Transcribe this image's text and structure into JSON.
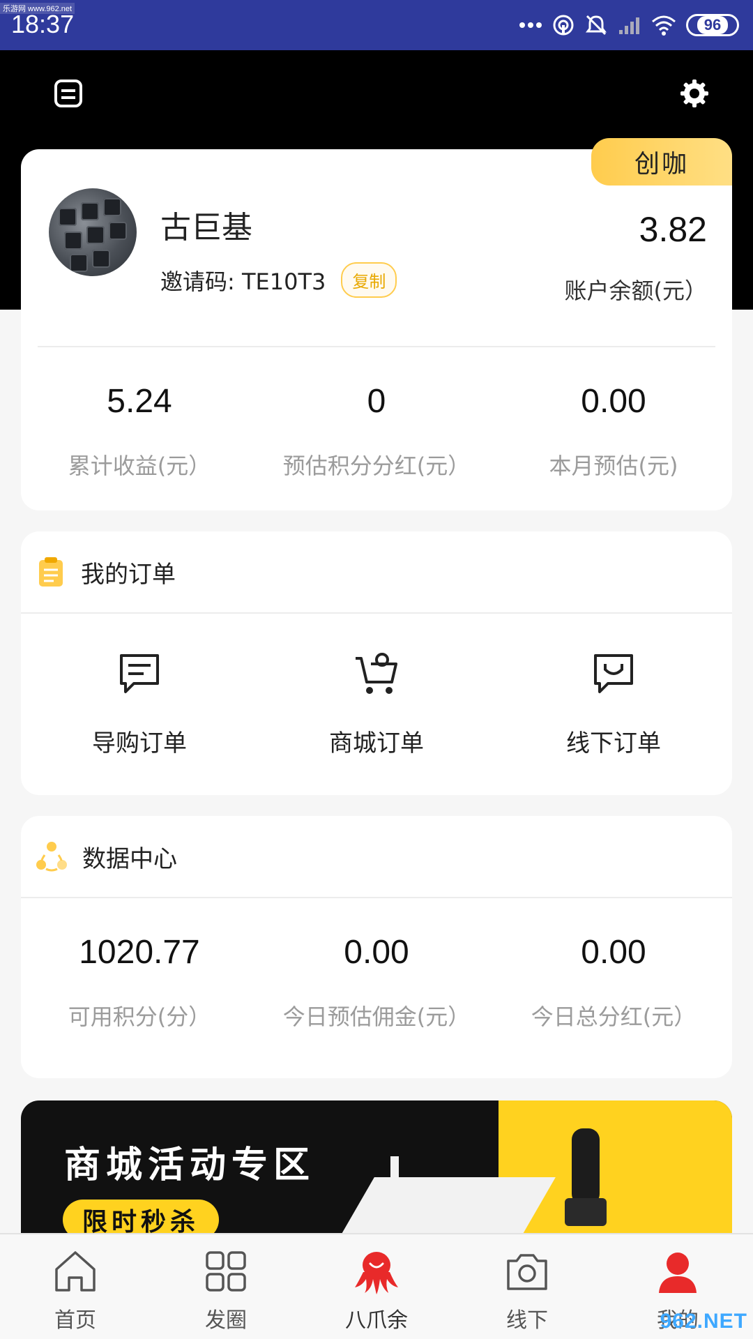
{
  "status_bar": {
    "time": "18:37",
    "battery": "96",
    "watermark": "乐游网 www.962.net"
  },
  "profile": {
    "badge": "创咖",
    "name": "古巨基",
    "invite_label": "邀请码: TE10T3",
    "copy_button": "复制",
    "balance_value": "3.82",
    "balance_label": "账户余额(元）"
  },
  "stats": [
    {
      "value": "5.24",
      "label": "累计收益(元）"
    },
    {
      "value": "0",
      "label": "预估积分分红(元）"
    },
    {
      "value": "0.00",
      "label": "本月预估(元)"
    }
  ],
  "orders": {
    "title": "我的订单",
    "items": [
      {
        "label": "导购订单",
        "icon": "message-square-icon"
      },
      {
        "label": "商城订单",
        "icon": "cart-icon"
      },
      {
        "label": "线下订单",
        "icon": "smile-bag-icon"
      }
    ]
  },
  "data_center": {
    "title": "数据中心",
    "items": [
      {
        "value": "1020.77",
        "label": "可用积分(分）"
      },
      {
        "value": "0.00",
        "label": "今日预估佣金(元）"
      },
      {
        "value": "0.00",
        "label": "今日总分红(元）"
      }
    ]
  },
  "banner": {
    "title": "商城活动专区",
    "pill": "限时秒杀"
  },
  "bottom_nav": [
    {
      "label": "首页",
      "icon": "home-icon"
    },
    {
      "label": "发圈",
      "icon": "grid-icon"
    },
    {
      "label": "八爪余",
      "icon": "octopus-icon"
    },
    {
      "label": "线下",
      "icon": "camera-icon"
    },
    {
      "label": "我的",
      "icon": "user-icon"
    }
  ],
  "watermark_bottom": "962.NET",
  "colors": {
    "status_bar": "#2f3a9c",
    "accent_yellow": "#ffcc4d",
    "active_red": "#e82a2a"
  }
}
